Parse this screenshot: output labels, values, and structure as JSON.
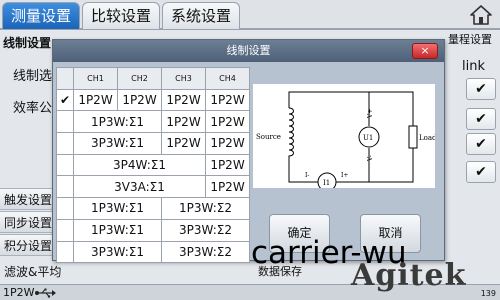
{
  "tabs": [
    {
      "label": "测量设置",
      "active": true
    },
    {
      "label": "比较设置",
      "active": false
    },
    {
      "label": "系统设置",
      "active": false
    }
  ],
  "background": {
    "left_header": "线制设置",
    "right_header": "量程设置",
    "wiring_select_label": "线制选",
    "efficiency_label": "效率公",
    "link_label": "link",
    "check_glyph": "✔",
    "side_buttons": [
      "触发设置",
      "同步设置",
      "积分设置"
    ],
    "filter_label": "滤波&平均",
    "data_save_label": "数据保存"
  },
  "dialog": {
    "title": "线制设置",
    "close_glyph": "×",
    "columns": [
      "CH1",
      "CH2",
      "CH3",
      "CH4"
    ],
    "rows": [
      {
        "mark": "✔",
        "cells": [
          {
            "text": "1P2W",
            "span": 1
          },
          {
            "text": "1P2W",
            "span": 1
          },
          {
            "text": "1P2W",
            "span": 1
          },
          {
            "text": "1P2W",
            "span": 1
          }
        ]
      },
      {
        "mark": "",
        "cells": [
          {
            "text": "1P3W:Σ1",
            "span": 2
          },
          {
            "text": "1P2W",
            "span": 1
          },
          {
            "text": "1P2W",
            "span": 1
          }
        ]
      },
      {
        "mark": "",
        "cells": [
          {
            "text": "3P3W:Σ1",
            "span": 2
          },
          {
            "text": "1P2W",
            "span": 1
          },
          {
            "text": "1P2W",
            "span": 1
          }
        ]
      },
      {
        "mark": "",
        "cells": [
          {
            "text": "3P4W:Σ1",
            "span": 3
          },
          {
            "text": "1P2W",
            "span": 1
          }
        ]
      },
      {
        "mark": "",
        "cells": [
          {
            "text": "3V3A:Σ1",
            "span": 3
          },
          {
            "text": "1P2W",
            "span": 1
          }
        ]
      },
      {
        "mark": "",
        "cells": [
          {
            "text": "1P3W:Σ1",
            "span": 2
          },
          {
            "text": "1P3W:Σ2",
            "span": 2
          }
        ]
      },
      {
        "mark": "",
        "cells": [
          {
            "text": "1P3W:Σ1",
            "span": 2
          },
          {
            "text": "3P3W:Σ2",
            "span": 2
          }
        ]
      },
      {
        "mark": "",
        "cells": [
          {
            "text": "3P3W:Σ1",
            "span": 2
          },
          {
            "text": "3P3W:Σ2",
            "span": 2
          }
        ]
      }
    ],
    "diagram": {
      "source": "Source",
      "load": "Load",
      "u1": "U1",
      "i1": "I1",
      "v_plus": "V+",
      "v_minus": "V-",
      "i_minus": "I-",
      "i_plus": "I+"
    },
    "ok_label": "确定",
    "cancel_label": "取消"
  },
  "status": {
    "mode": "1P2W",
    "page_number": "139"
  },
  "watermark": {
    "text": "carrier-wu",
    "logo": "Agitek"
  },
  "colors": {
    "tab_active": "#1b64b8",
    "dialog_title": "#4e6078",
    "close_button": "#c62828"
  }
}
